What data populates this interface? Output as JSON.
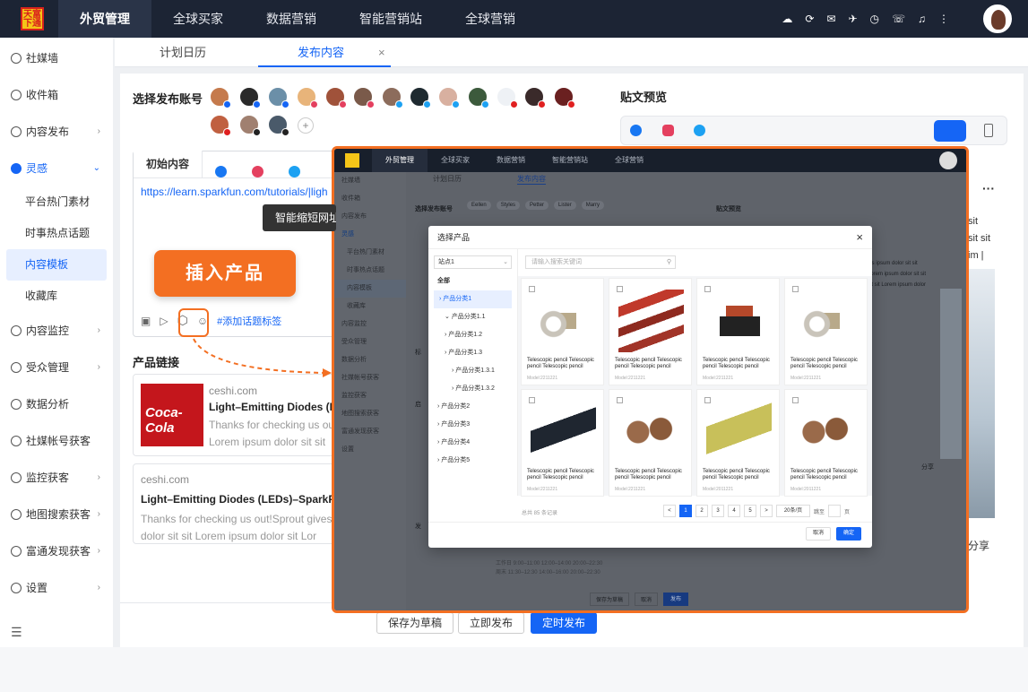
{
  "logo": {
    "text": "天富 下通"
  },
  "nav": {
    "items": [
      "外贸管理",
      "全球买家",
      "数据营销",
      "智能营销站",
      "全球营销"
    ],
    "active": 0
  },
  "sidebar": {
    "items": [
      {
        "label": "社媒墙",
        "arrow": ""
      },
      {
        "label": "收件箱",
        "arrow": ""
      },
      {
        "label": "内容发布",
        "arrow": "›"
      },
      {
        "label": "灵感",
        "arrow": "⌄"
      }
    ],
    "sub": [
      "平台热门素材",
      "时事热点话题",
      "内容模板",
      "收藏库"
    ],
    "items2": [
      {
        "label": "内容监控",
        "arrow": "›"
      },
      {
        "label": "受众管理",
        "arrow": "›"
      },
      {
        "label": "数据分析",
        "arrow": ""
      },
      {
        "label": "社媒帐号获客",
        "arrow": ""
      },
      {
        "label": "监控获客",
        "arrow": "›"
      },
      {
        "label": "地图搜索获客",
        "arrow": "›"
      },
      {
        "label": "富通发现获客",
        "arrow": "›"
      },
      {
        "label": "设置",
        "arrow": "›"
      }
    ],
    "collapse": "☰"
  },
  "tabs": {
    "calendar": "计划日历",
    "publish": "发布内容",
    "close": "×"
  },
  "publish": {
    "select_account": "选择发布账号",
    "plus": "+",
    "editor_tab": "初始内容",
    "url": "https://learn.sparkfun.com/tutorials/|ligh",
    "tooltip": "智能缩短网址",
    "insert_product": "插入产品",
    "add_hashtag": "#添加话题标签",
    "product_link": "产品链接"
  },
  "cards": [
    {
      "domain": "ceshi.com",
      "title": "Light–Emitting Diodes (LE",
      "desc1": "Thanks for checking us ou",
      "desc2": "Lorem ipsum dolor sit sit"
    },
    {
      "domain": "ceshi.com",
      "title": "Light–Emitting Diodes (LEDs)–SparkFun",
      "desc1": "Thanks for checking us out!Sprout gives",
      "desc2": "dolor sit sit Lorem ipsum dolor sit Lor"
    }
  ],
  "coke_text": "Coca-Cola",
  "bottom_buttons": {
    "draft": "保存为草稿",
    "publish_now": "立即发布",
    "schedule": "定时发布"
  },
  "preview": {
    "title": "贴文预览",
    "more": "···",
    "texts": [
      "sit",
      "sit sit",
      "im |"
    ],
    "share": "分享"
  },
  "shot": {
    "nav": [
      "外贸管理",
      "全球买家",
      "数据营销",
      "智能营销站",
      "全球营销"
    ],
    "sidebar": [
      "社媒墙",
      "收件箱",
      "内容发布",
      "灵感",
      "平台热门素材",
      "时事热点话题",
      "内容模板",
      "收藏库",
      "内容监控",
      "受众管理",
      "数据分析",
      "社媒帐号获客",
      "监控获客",
      "地图搜索获客",
      "富通发现获客",
      "设置"
    ],
    "tabs": [
      "计划日历",
      "发布内容"
    ],
    "accounts": [
      "Eellen",
      "Styles",
      "Petter",
      "Lister",
      "Marry"
    ],
    "select_account": "选择发布账号",
    "preview_title": "贴文预览",
    "lorem": [
      "ols ipsum dolor sit sit",
      "Lorem ipsum dolor sit sit",
      "sit sit Lorem ipsum dolor"
    ],
    "share": "分享",
    "hours": [
      "工作日  9:00–11:00  12:00–14:00  20:00–22:30",
      "周末  11:30–12:30  14:00–16:00  20:00–22:30"
    ],
    "bottom": [
      "保存为草稿",
      "取消",
      "发布"
    ],
    "label_biao": "标",
    "label_qi": "启",
    "label_fa": "发"
  },
  "modal": {
    "title": "选择产品",
    "site": "站点1",
    "search_placeholder": "请输入搜索关键词",
    "tree": [
      "全部",
      "产品分类1",
      "产品分类1.1",
      "产品分类1.2",
      "产品分类1.3",
      "产品分类1.3.1",
      "产品分类1.3.2",
      "产品分类2",
      "产品分类3",
      "产品分类4",
      "产品分类5"
    ],
    "total": "总共 85 条记录",
    "pages": [
      "<",
      "1",
      "2",
      "3",
      "4",
      "5",
      ">"
    ],
    "page_size": "20条/页",
    "jump": "跳至",
    "page_unit": "页",
    "cancel": "取消",
    "ok": "确定",
    "products": [
      {
        "name": "Telescopic pencil Telescopic pencil Telescopic pencil",
        "model": "Model:2211221",
        "kind": "connector"
      },
      {
        "name": "Telescopic pencil Telescopic pencil Telescopic pencil",
        "model": "Model:2211221",
        "kind": "resistors"
      },
      {
        "name": "Telescopic pencil Telescopic pencil Telescopic pencil",
        "model": "Model:2211221",
        "kind": "relay"
      },
      {
        "name": "Telescopic pencil Telescopic pencil Telescopic pencil",
        "model": "Model:2211221",
        "kind": "connector"
      },
      {
        "name": "Telescopic pencil Telescopic pencil Telescopic pencil",
        "model": "Model:2211221",
        "kind": "cable"
      },
      {
        "name": "Telescopic pencil Telescopic pencil Telescopic pencil",
        "model": "Model:2211221",
        "kind": "coil"
      },
      {
        "name": "Telescopic pencil Telescopic pencil Telescopic pencil",
        "model": "Model:2011221",
        "kind": "board"
      },
      {
        "name": "Telescopic pencil Telescopic pencil Telescopic pencil",
        "model": "Model:2011221",
        "kind": "coil"
      }
    ]
  }
}
